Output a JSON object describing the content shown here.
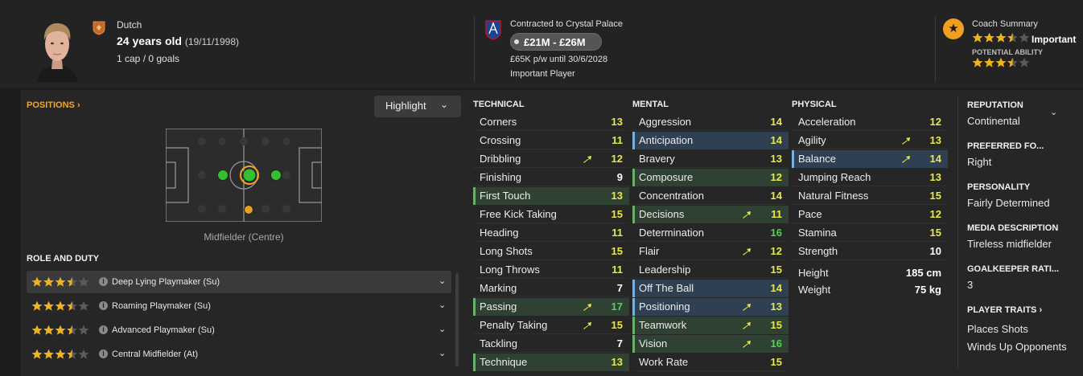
{
  "header": {
    "nationality": "Dutch",
    "age": "24 years old",
    "dob": "(19/11/1998)",
    "caps": "1 cap / 0 goals",
    "contract": "Contracted to Crystal Palace",
    "value": "£21M - £26M",
    "wage": "£65K p/w until 30/6/2028",
    "squad_status": "Important Player",
    "coach_summary_title": "Coach Summary",
    "coach_verdict": "Important",
    "current_ability_stars": 3.5,
    "potential_ability_label": "POTENTIAL ABILITY",
    "potential_ability_stars": 3.5
  },
  "positions": {
    "title": "POSITIONS",
    "highlight_label": "Highlight",
    "position_label": "Midfielder (Centre)"
  },
  "roles": {
    "title": "ROLE AND DUTY",
    "items": [
      {
        "name": "Deep Lying Playmaker (Su)",
        "stars": 3.5,
        "selected": true
      },
      {
        "name": "Roaming Playmaker (Su)",
        "stars": 3.5,
        "selected": false
      },
      {
        "name": "Advanced Playmaker (Su)",
        "stars": 3.5,
        "selected": false
      },
      {
        "name": "Central Midfielder (At)",
        "stars": 3.5,
        "selected": false
      }
    ]
  },
  "technical": {
    "title": "TECHNICAL",
    "rows": [
      {
        "name": "Corners",
        "value": "13",
        "hl": "",
        "arrow": false
      },
      {
        "name": "Crossing",
        "value": "11",
        "hl": "",
        "arrow": false
      },
      {
        "name": "Dribbling",
        "value": "12",
        "hl": "",
        "arrow": true
      },
      {
        "name": "Finishing",
        "value": "9",
        "hl": "",
        "arrow": false
      },
      {
        "name": "First Touch",
        "value": "13",
        "hl": "green",
        "arrow": false
      },
      {
        "name": "Free Kick Taking",
        "value": "15",
        "hl": "",
        "arrow": false
      },
      {
        "name": "Heading",
        "value": "11",
        "hl": "",
        "arrow": false
      },
      {
        "name": "Long Shots",
        "value": "15",
        "hl": "",
        "arrow": false
      },
      {
        "name": "Long Throws",
        "value": "11",
        "hl": "",
        "arrow": false
      },
      {
        "name": "Marking",
        "value": "7",
        "hl": "",
        "arrow": false
      },
      {
        "name": "Passing",
        "value": "17",
        "hl": "green",
        "arrow": true
      },
      {
        "name": "Penalty Taking",
        "value": "15",
        "hl": "",
        "arrow": true
      },
      {
        "name": "Tackling",
        "value": "7",
        "hl": "",
        "arrow": false
      },
      {
        "name": "Technique",
        "value": "13",
        "hl": "green",
        "arrow": false
      }
    ]
  },
  "mental": {
    "title": "MENTAL",
    "rows": [
      {
        "name": "Aggression",
        "value": "14",
        "hl": "",
        "arrow": false
      },
      {
        "name": "Anticipation",
        "value": "14",
        "hl": "blue",
        "arrow": false
      },
      {
        "name": "Bravery",
        "value": "13",
        "hl": "",
        "arrow": false
      },
      {
        "name": "Composure",
        "value": "12",
        "hl": "green",
        "arrow": false
      },
      {
        "name": "Concentration",
        "value": "14",
        "hl": "",
        "arrow": false
      },
      {
        "name": "Decisions",
        "value": "11",
        "hl": "green",
        "arrow": true
      },
      {
        "name": "Determination",
        "value": "16",
        "hl": "",
        "arrow": false
      },
      {
        "name": "Flair",
        "value": "12",
        "hl": "",
        "arrow": true
      },
      {
        "name": "Leadership",
        "value": "15",
        "hl": "",
        "arrow": false
      },
      {
        "name": "Off The Ball",
        "value": "14",
        "hl": "blue",
        "arrow": false
      },
      {
        "name": "Positioning",
        "value": "13",
        "hl": "blue",
        "arrow": true
      },
      {
        "name": "Teamwork",
        "value": "15",
        "hl": "green",
        "arrow": true
      },
      {
        "name": "Vision",
        "value": "16",
        "hl": "green",
        "arrow": true
      },
      {
        "name": "Work Rate",
        "value": "15",
        "hl": "",
        "arrow": false
      }
    ]
  },
  "physical": {
    "title": "PHYSICAL",
    "rows": [
      {
        "name": "Acceleration",
        "value": "12",
        "hl": "",
        "arrow": false
      },
      {
        "name": "Agility",
        "value": "13",
        "hl": "",
        "arrow": true
      },
      {
        "name": "Balance",
        "value": "14",
        "hl": "blue",
        "arrow": true
      },
      {
        "name": "Jumping Reach",
        "value": "13",
        "hl": "",
        "arrow": false
      },
      {
        "name": "Natural Fitness",
        "value": "15",
        "hl": "",
        "arrow": false
      },
      {
        "name": "Pace",
        "value": "12",
        "hl": "",
        "arrow": false
      },
      {
        "name": "Stamina",
        "value": "15",
        "hl": "",
        "arrow": false
      },
      {
        "name": "Strength",
        "value": "10",
        "hl": "",
        "arrow": false
      }
    ],
    "height_label": "Height",
    "height_value": "185 cm",
    "weight_label": "Weight",
    "weight_value": "75 kg"
  },
  "sidebar": {
    "items": [
      {
        "title": "REPUTATION",
        "value": "Continental"
      },
      {
        "title": "PREFERRED FO...",
        "value": "Right"
      },
      {
        "title": "PERSONALITY",
        "value": "Fairly Determined"
      },
      {
        "title": "MEDIA DESCRIPTION",
        "value": "Tireless midfielder"
      },
      {
        "title": "GOALKEEPER RATI...",
        "value": "3"
      }
    ],
    "traits_title": "PLAYER TRAITS",
    "traits": [
      "Places Shots",
      "Winds Up Opponents"
    ]
  },
  "colors": {
    "accent": "#f5a623",
    "value_yellow": "#e8e84a",
    "value_green": "#52d452",
    "value_white": "#ffffff"
  }
}
